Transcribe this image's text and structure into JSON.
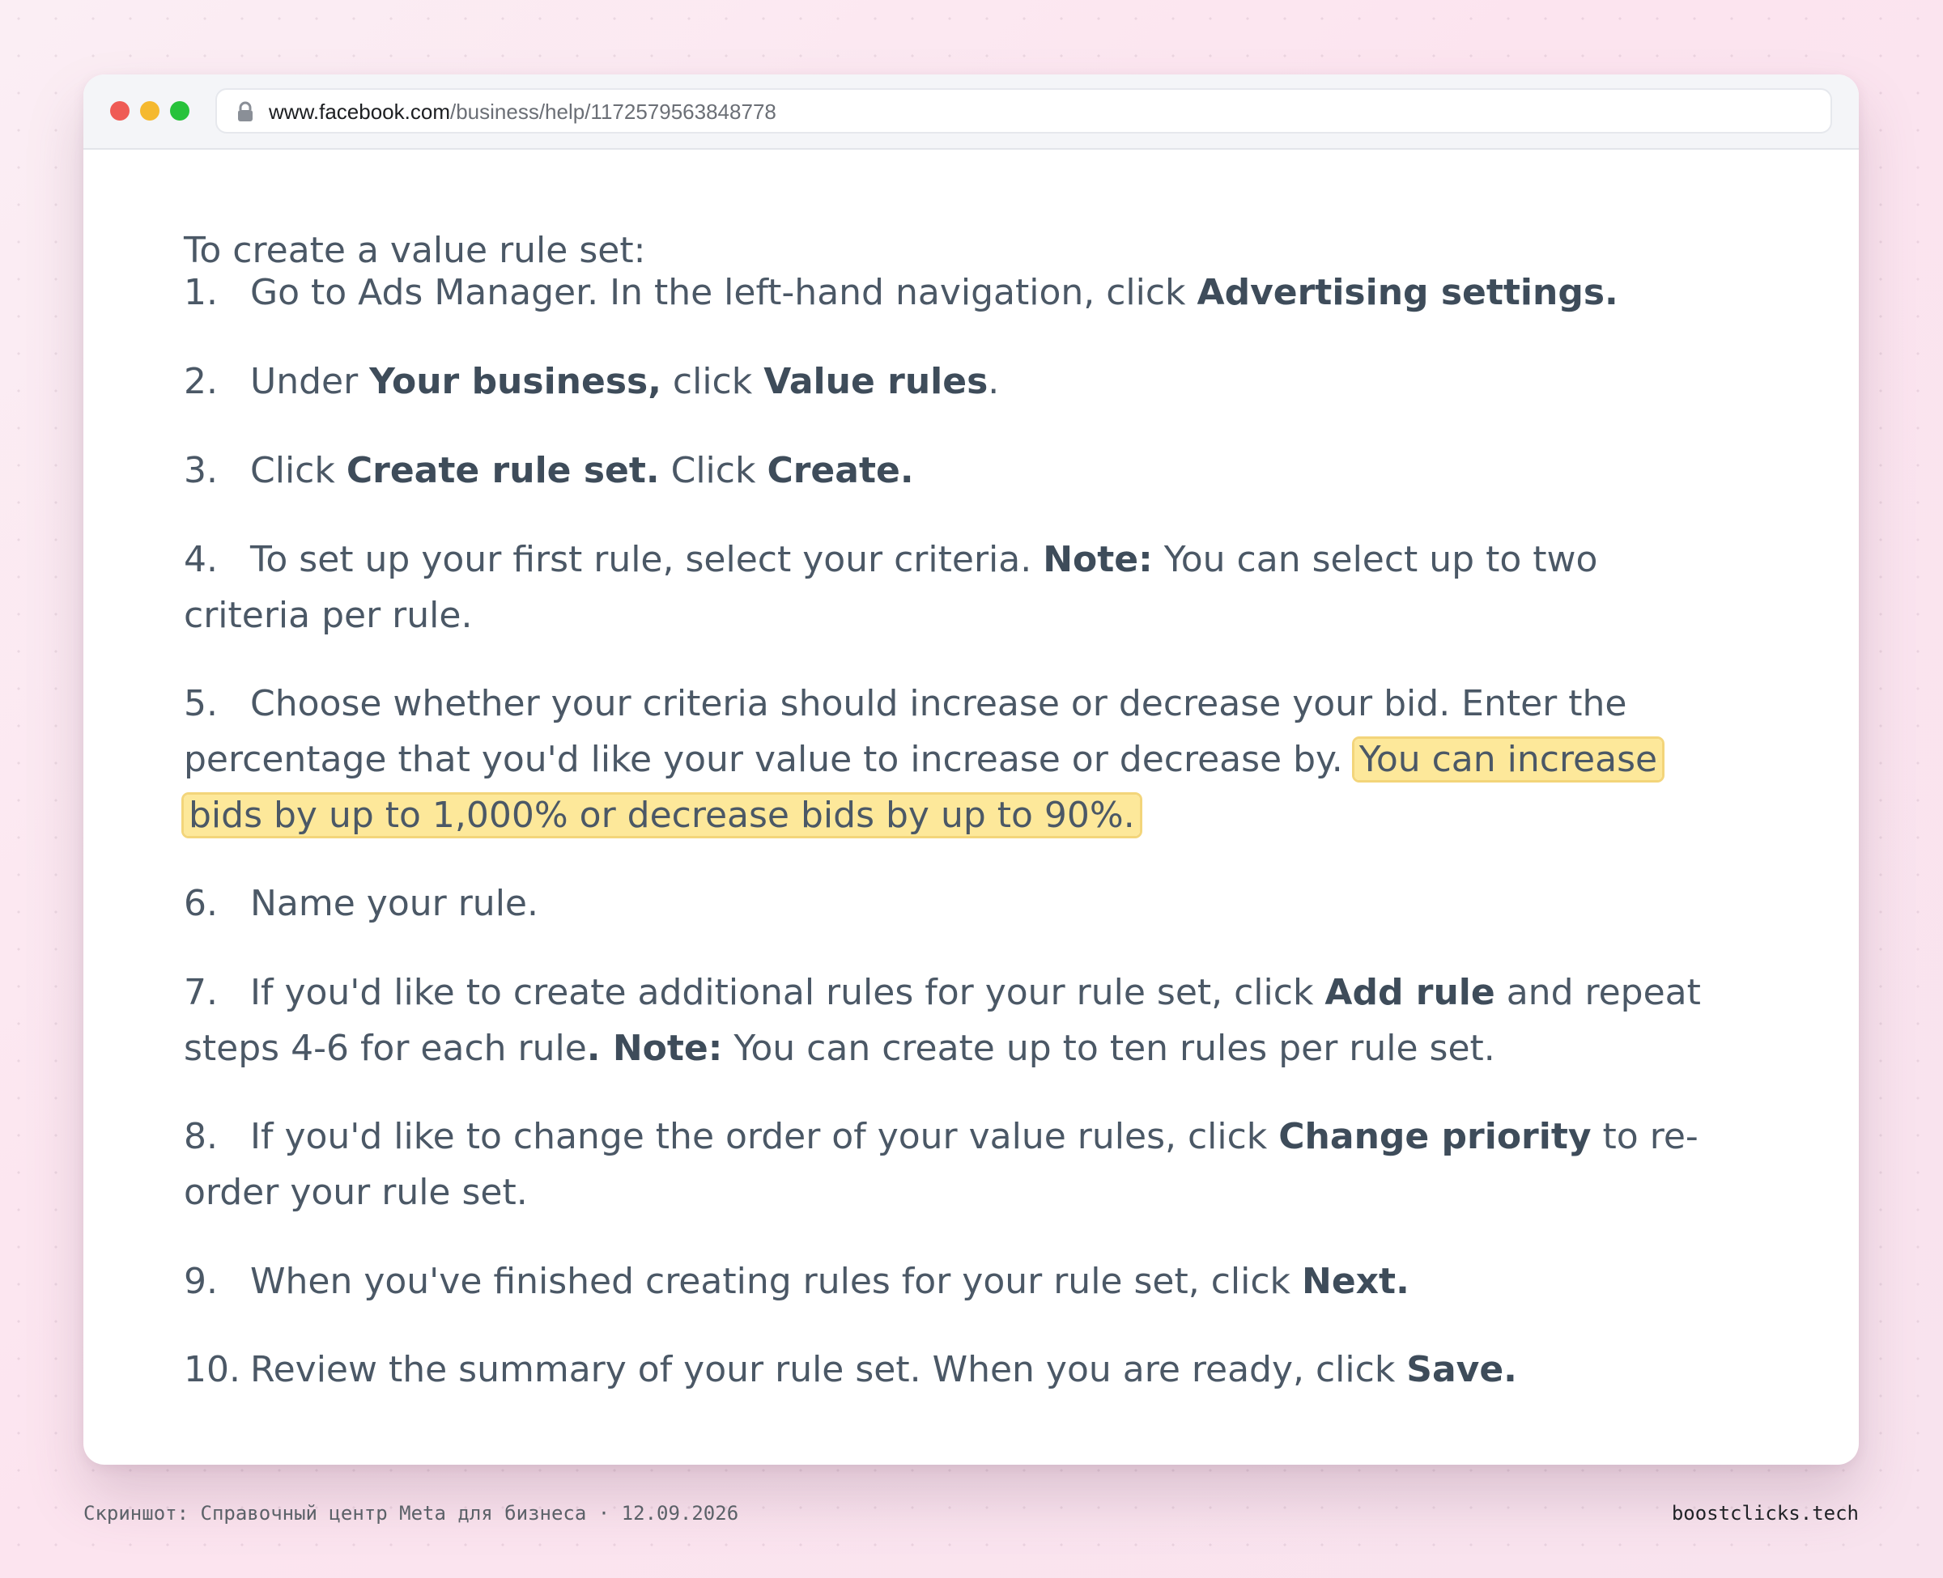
{
  "browser": {
    "url_domain": "www.facebook.com",
    "url_path": "/business/help/1172579563848778",
    "lock_icon": "lock-icon"
  },
  "article": {
    "intro": "To create a value rule set:",
    "steps": [
      {
        "number": "1.",
        "parts": [
          "Go to Ads Manager. In the left-hand navigation, click ",
          "Advertising settings."
        ]
      },
      {
        "number": "2.",
        "parts": [
          "Under ",
          "Your business,",
          " click ",
          "Value rules",
          "."
        ]
      },
      {
        "number": "3.",
        "parts": [
          "Click ",
          "Create rule set.",
          " Click ",
          "Create."
        ]
      },
      {
        "number": "4.",
        "parts": [
          "To set up your first rule, select your criteria. ",
          "Note:",
          " You can select up to two criteria per rule."
        ]
      },
      {
        "number": "5.",
        "parts": [
          "Choose whether your criteria should increase or decrease your bid. Enter the percentage that you'd like your value to increase or decrease by. ",
          "You can increase bids by up to 1,000% or decrease bids by up to 90%."
        ]
      },
      {
        "number": "6.",
        "parts": [
          "Name your rule."
        ]
      },
      {
        "number": "7.",
        "parts": [
          "If you'd like to create additional rules for your rule set, click ",
          "Add rule",
          " and repeat steps 4-6 for each rule",
          ". Note:",
          " You can create up to ten rules per rule set."
        ]
      },
      {
        "number": "8.",
        "parts": [
          "If you'd like to change the order of your value rules, click ",
          "Change priority",
          " to re-order your rule set."
        ]
      },
      {
        "number": "9.",
        "parts": [
          "When you've finished creating rules for your rule set, click ",
          "Next."
        ]
      },
      {
        "number": "10.",
        "parts": [
          "Review the summary of your rule set. When you are ready, click ",
          "Save."
        ]
      }
    ]
  },
  "footer": {
    "caption": "Скриншот: Справочный центр Meta для бизнеса · 12.09.2026",
    "brand": "boostclicks.tech"
  },
  "colors": {
    "highlight": "#fde89a",
    "text": "#4b5866",
    "traffic_red": "#ef5b55",
    "traffic_yellow": "#f5b92f",
    "traffic_green": "#27c23b"
  }
}
